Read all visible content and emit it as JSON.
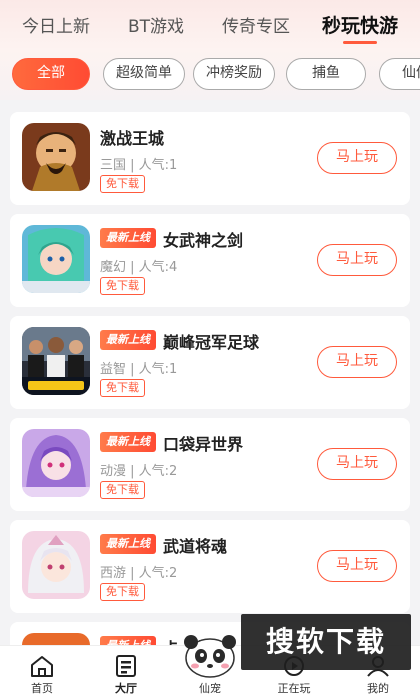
{
  "top_tabs": [
    {
      "label": "今日上新",
      "active": false
    },
    {
      "label": "BT游戏",
      "active": false
    },
    {
      "label": "传奇专区",
      "active": false
    },
    {
      "label": "秒玩快游",
      "active": true
    }
  ],
  "filters": [
    {
      "label": "全部",
      "active": true
    },
    {
      "label": "超级简单",
      "active": false
    },
    {
      "label": "冲榜奖励",
      "active": false
    },
    {
      "label": "捕鱼",
      "active": false
    },
    {
      "label": "仙侠",
      "active": false
    }
  ],
  "games": [
    {
      "name": "激战王城",
      "meta": "三国 | 人气:1",
      "free_label": "免下载",
      "new_badge": "",
      "play_label": "马上玩"
    },
    {
      "name": "女武神之剑",
      "meta": "魔幻 | 人气:4",
      "free_label": "免下载",
      "new_badge": "最新上线",
      "play_label": "马上玩"
    },
    {
      "name": "巅峰冠军足球",
      "meta": "益智 | 人气:1",
      "free_label": "免下载",
      "new_badge": "最新上线",
      "play_label": "马上玩"
    },
    {
      "name": "口袋异世界",
      "meta": "动漫 | 人气:2",
      "free_label": "免下载",
      "new_badge": "最新上线",
      "play_label": "马上玩"
    },
    {
      "name": "武道将魂",
      "meta": "西游 | 人气:2",
      "free_label": "免下载",
      "new_badge": "最新上线",
      "play_label": "马上玩"
    },
    {
      "name": "卡卡保息",
      "meta": "",
      "free_label": "",
      "new_badge": "最新上线",
      "play_label": ""
    }
  ],
  "bottom_nav": [
    {
      "label": "首页",
      "icon": "home-icon",
      "active": false
    },
    {
      "label": "大厅",
      "icon": "hall-icon",
      "active": true
    },
    {
      "label": "仙宠",
      "icon": "pet-icon",
      "active": false
    },
    {
      "label": "正在玩",
      "icon": "playing-icon",
      "active": false
    },
    {
      "label": "我的",
      "icon": "profile-icon",
      "active": false
    }
  ],
  "watermark": "搜软下载",
  "colors": {
    "accent": "#ff5a3c",
    "background": "#f3f3f5"
  }
}
